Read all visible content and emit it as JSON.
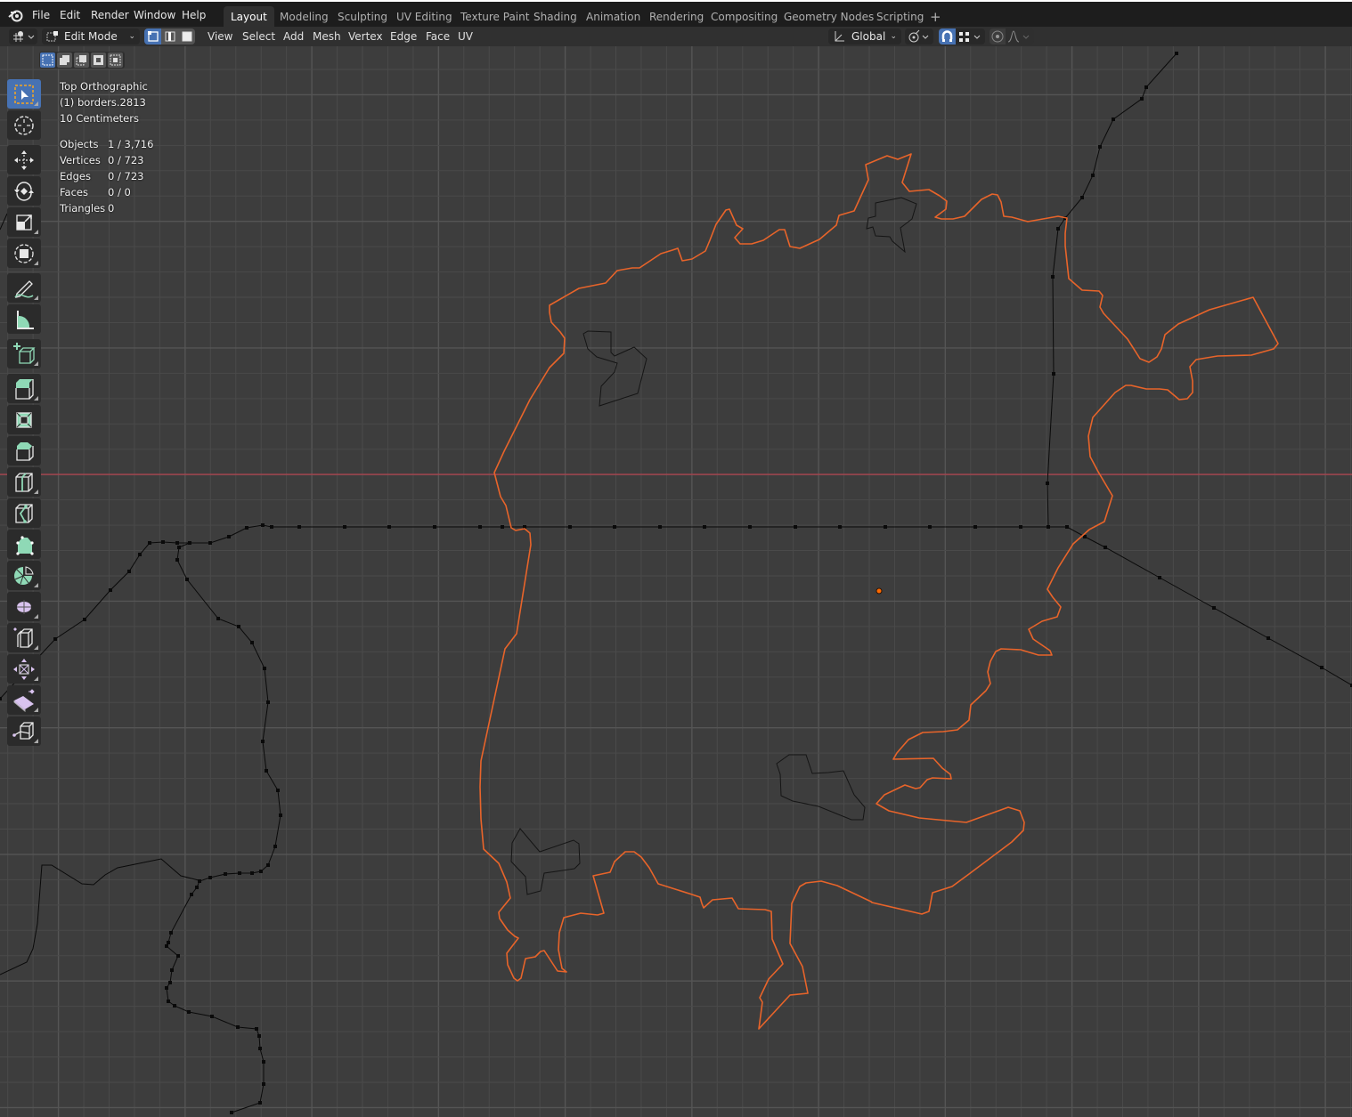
{
  "app": {
    "logo_icon": "blender-logo-icon"
  },
  "menu": [
    "File",
    "Edit",
    "Render",
    "Window",
    "Help"
  ],
  "workspaces": {
    "active": "Layout",
    "tabs": [
      "Layout",
      "Modeling",
      "Sculpting",
      "UV Editing",
      "Texture Paint",
      "Shading",
      "Animation",
      "Rendering",
      "Compositing",
      "Geometry Nodes",
      "Scripting"
    ],
    "add_label": "+"
  },
  "header": {
    "editor_type_icon": "3d-viewport-icon",
    "mode": "Edit Mode",
    "select_modes": [
      "vertex-select-icon",
      "edge-select-icon",
      "face-select-icon"
    ],
    "active_select_mode": "vertex",
    "menus": [
      "View",
      "Select",
      "Add",
      "Mesh",
      "Vertex",
      "Edge",
      "Face",
      "UV"
    ],
    "transform_orientation": "Global",
    "pivot_icon": "pivot-point-icon",
    "snap_icon": "snap-magnet-icon",
    "snap_enabled": true,
    "snap_target_icon": "snap-increment-icon",
    "proportional_icon": "proportional-edit-icon",
    "falloff_icon": "falloff-curve-icon"
  },
  "selection_box_modes": [
    "set-new-selection-icon",
    "extend-selection-icon",
    "subtract-selection-icon",
    "invert-selection-icon",
    "intersect-selection-icon"
  ],
  "overlay": {
    "view_name": "Top Orthographic",
    "object_name": "(1) borders.2813",
    "grid_scale": "10 Centimeters",
    "stats": [
      {
        "label": "Objects",
        "value": "1 / 3,716"
      },
      {
        "label": "Vertices",
        "value": "0 / 723"
      },
      {
        "label": "Edges",
        "value": "0 / 723"
      },
      {
        "label": "Faces",
        "value": "0 / 0"
      },
      {
        "label": "Triangles",
        "value": "0"
      }
    ]
  },
  "toolbar": [
    {
      "name": "select-box-tool",
      "icon": "select-box-icon",
      "active": true
    },
    {
      "name": "cursor-tool",
      "icon": "cursor-icon"
    },
    {
      "name": "move-tool",
      "icon": "move-icon"
    },
    {
      "name": "rotate-tool",
      "icon": "rotate-icon"
    },
    {
      "name": "scale-tool",
      "icon": "scale-icon"
    },
    {
      "name": "transform-tool",
      "icon": "transform-icon"
    },
    {
      "name": "annotate-tool",
      "icon": "annotate-icon"
    },
    {
      "name": "measure-tool",
      "icon": "measure-icon"
    },
    {
      "name": "add-cube-tool",
      "icon": "add-cube-icon"
    },
    {
      "name": "extrude-region-tool",
      "icon": "extrude-region-icon"
    },
    {
      "name": "inset-faces-tool",
      "icon": "inset-faces-icon"
    },
    {
      "name": "bevel-tool",
      "icon": "bevel-icon"
    },
    {
      "name": "loop-cut-tool",
      "icon": "loop-cut-icon"
    },
    {
      "name": "knife-tool",
      "icon": "knife-icon"
    },
    {
      "name": "poly-build-tool",
      "icon": "poly-build-icon"
    },
    {
      "name": "spin-tool",
      "icon": "spin-icon"
    },
    {
      "name": "smooth-tool",
      "icon": "smooth-icon"
    },
    {
      "name": "edge-slide-tool",
      "icon": "edge-slide-icon"
    },
    {
      "name": "shrink-fatten-tool",
      "icon": "shrink-fatten-icon"
    },
    {
      "name": "shear-tool",
      "icon": "shear-icon"
    },
    {
      "name": "rip-region-tool",
      "icon": "rip-region-icon"
    }
  ],
  "colors": {
    "accent": "#4772b3",
    "selected_edge": "#e8642a",
    "x_axis": "#b3424e",
    "wire": "#0a0a0a",
    "viewport_bg": "#3d3d3d",
    "topbar_bg": "#1d1d1d",
    "header_bg": "#303030"
  }
}
